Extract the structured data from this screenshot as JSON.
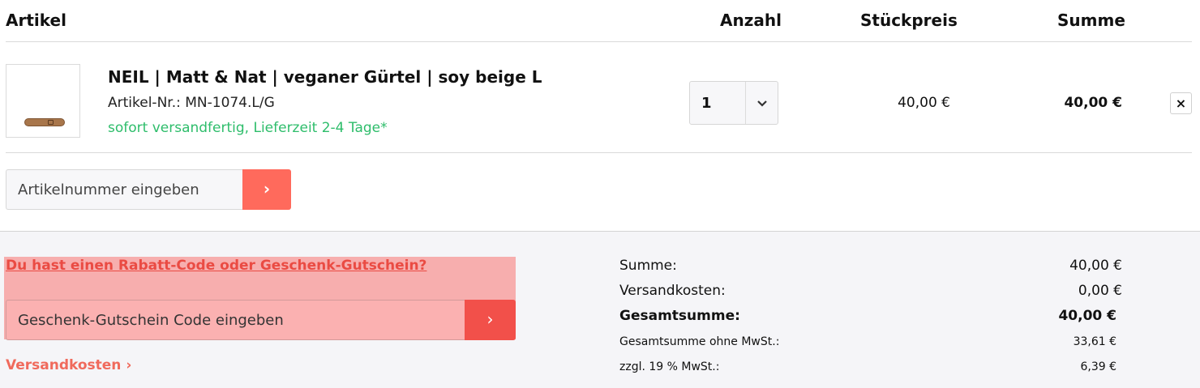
{
  "table_header": {
    "article": "Artikel",
    "quantity": "Anzahl",
    "unit_price": "Stückpreis",
    "sum": "Summe"
  },
  "item": {
    "title": "NEIL | Matt & Nat | veganer Gürtel | soy beige L",
    "article_number": "Artikel-Nr.: MN-1074.L/G",
    "availability": "sofort versandfertig, Lieferzeit 2-4 Tage*",
    "quantity": "1",
    "unit_price": "40,00 €",
    "line_total": "40,00 €",
    "image_icon": "belt-product-image",
    "remove_icon": "×",
    "quantity_chevron": "⌄"
  },
  "article_input": {
    "placeholder": "Artikelnummer eingeben",
    "button_icon": "›"
  },
  "voucher": {
    "link_text": "Du hast einen Rabatt-Code oder Geschenk-Gutschein?",
    "placeholder": "Geschenk-Gutschein Code eingeben",
    "button_icon": "›"
  },
  "shipping_link": "Versandkosten ›",
  "summary": {
    "subtotal_label": "Summe:",
    "subtotal_value": "40,00 €",
    "shipping_label": "Versandkosten:",
    "shipping_value": "0,00 €",
    "total_label": "Gesamtsumme:",
    "total_value": "40,00 €",
    "net_label": "Gesamtsumme ohne MwSt.:",
    "net_value": "33,61 €",
    "vat_label": "zzgl. 19 % MwSt.:",
    "vat_value": "6,39 €"
  },
  "colors": {
    "accent": "#ff6a5c",
    "link": "#ea4b43",
    "success": "#2ebd6b",
    "highlight": "#f7aeae"
  }
}
